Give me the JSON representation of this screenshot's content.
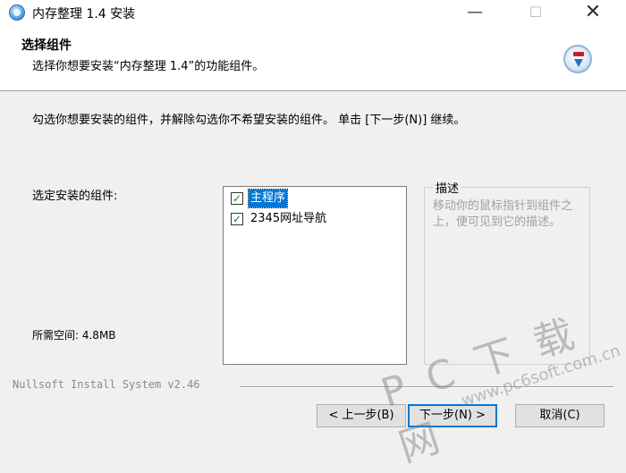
{
  "window": {
    "title": "内存整理 1.4 安装",
    "minimize_glyph": "—",
    "maximize_glyph": "☐",
    "close_glyph": "✕"
  },
  "header": {
    "title": "选择组件",
    "subtitle": "选择你想要安装“内存整理 1.4”的功能组件。"
  },
  "body": {
    "instruction": "勾选你想要安装的组件，并解除勾选你不希望安装的组件。 单击 [下一步(N)] 继续。",
    "components_label": "选定安装的组件:",
    "space_required": "所需空间: 4.8MB",
    "components": [
      {
        "label": "主程序",
        "checked": true,
        "selected": true
      },
      {
        "label": "2345网址导航",
        "checked": true,
        "selected": false
      }
    ],
    "description": {
      "title": "描述",
      "text": "移动你的鼠标指针到组件之上，便可见到它的描述。"
    }
  },
  "footer": {
    "branding": "Nullsoft Install System v2.46",
    "back_label": "< 上一步(B)",
    "next_label": "下一步(N) >",
    "cancel_label": "取消(C)"
  },
  "watermark": {
    "main": "P C 下 载 网",
    "url": "www.pc6soft.com.cn"
  },
  "icons": {
    "app": "installer-globe-icon",
    "header": "installer-download-icon"
  },
  "colors": {
    "selection": "#0078d7",
    "check": "#1a7f1a"
  }
}
